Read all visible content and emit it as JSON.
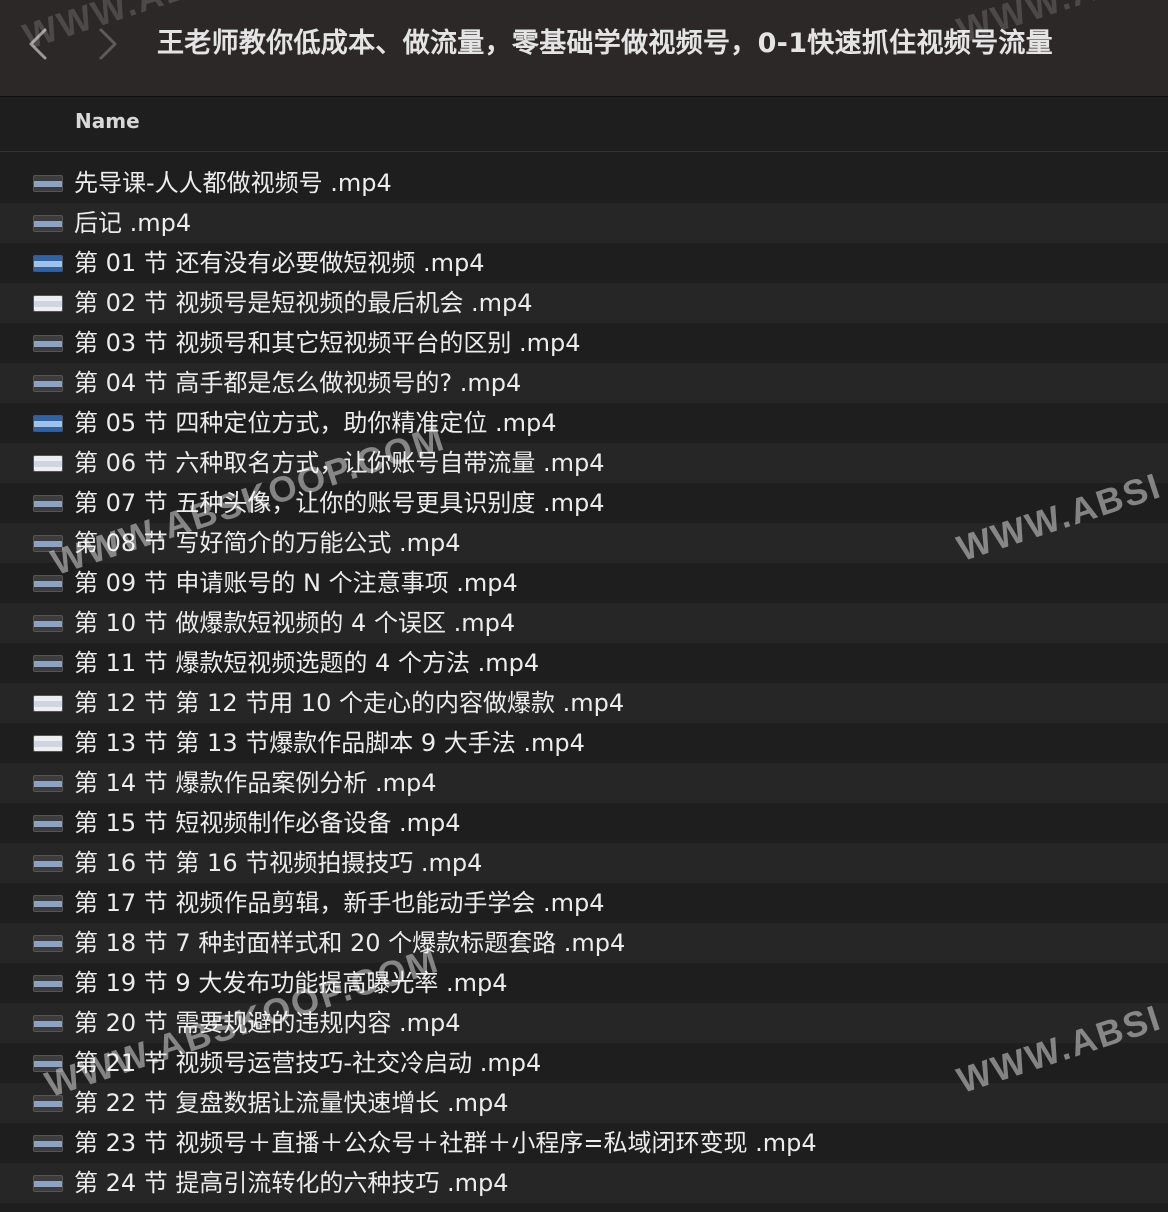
{
  "window": {
    "title": "王老师教你低成本、做流量，零基础学做视频号，0-1快速抓住视频号流量",
    "back_icon": "chevron-left-icon",
    "forward_icon": "chevron-right-icon"
  },
  "list_header": {
    "name_label": "Name"
  },
  "files": [
    {
      "name": "先导课-人人都做视频号 .mp4",
      "thumb": "dark"
    },
    {
      "name": "后记 .mp4",
      "thumb": "dark"
    },
    {
      "name": "第 01 节  还有没有必要做短视频 .mp4",
      "thumb": "blue"
    },
    {
      "name": "第 02 节  视频号是短视频的最后机会 .mp4",
      "thumb": "white"
    },
    {
      "name": "第 03 节  视频号和其它短视频平台的区别 .mp4",
      "thumb": "dark"
    },
    {
      "name": "第 04 节  高手都是怎么做视频号的?   .mp4",
      "thumb": "dark"
    },
    {
      "name": "第 05 节  四种定位方式，助你精准定位 .mp4",
      "thumb": "blue"
    },
    {
      "name": "第 06 节  六种取名方式，让你账号自带流量 .mp4",
      "thumb": "white"
    },
    {
      "name": "第 07 节  五种头像，让你的账号更具识别度 .mp4",
      "thumb": "dark"
    },
    {
      "name": "第 08 节  写好简介的万能公式 .mp4",
      "thumb": "dark"
    },
    {
      "name": "第 09 节  申请账号的 N 个注意事项 .mp4",
      "thumb": "dark"
    },
    {
      "name": "第 10 节  做爆款短视频的 4 个误区 .mp4",
      "thumb": "dark"
    },
    {
      "name": "第 11 节  爆款短视频选题的 4 个方法 .mp4",
      "thumb": "dark"
    },
    {
      "name": "第 12 节  第 12 节用 10 个走心的内容做爆款 .mp4",
      "thumb": "white"
    },
    {
      "name": "第 13 节  第 13 节爆款作品脚本 9 大手法 .mp4",
      "thumb": "white"
    },
    {
      "name": "第 14 节  爆款作品案例分析 .mp4",
      "thumb": "dark"
    },
    {
      "name": "第 15 节  短视频制作必备设备 .mp4",
      "thumb": "dark"
    },
    {
      "name": "第 16 节  第 16 节视频拍摄技巧 .mp4",
      "thumb": "dark"
    },
    {
      "name": "第 17 节  视频作品剪辑，新手也能动手学会 .mp4",
      "thumb": "dark"
    },
    {
      "name": "第 18 节  7 种封面样式和 20 个爆款标题套路 .mp4",
      "thumb": "dark"
    },
    {
      "name": "第 19 节  9 大发布功能提高曝光率 .mp4",
      "thumb": "dark"
    },
    {
      "name": "第 20 节  需要规避的违规内容 .mp4",
      "thumb": "dark"
    },
    {
      "name": "第 21 节  视频号运营技巧-社交冷启动 .mp4",
      "thumb": "dark"
    },
    {
      "name": "第 22 节  复盘数据让流量快速增长 .mp4",
      "thumb": "dark"
    },
    {
      "name": "第 23 节  视频号＋直播＋公众号＋社群＋小程序=私域闭环变现 .mp4",
      "thumb": "dark"
    },
    {
      "name": "第 24 节  提高引流转化的六种技巧 .mp4",
      "thumb": "dark"
    }
  ],
  "watermarks": {
    "text_a": "WWW.ABSKOOP.COM",
    "text_b": "WWW.ABSI"
  },
  "colors": {
    "background": "#1e1e1e",
    "titlebar": "#2b2827",
    "row_alt": "#262626",
    "text": "#ececec"
  }
}
